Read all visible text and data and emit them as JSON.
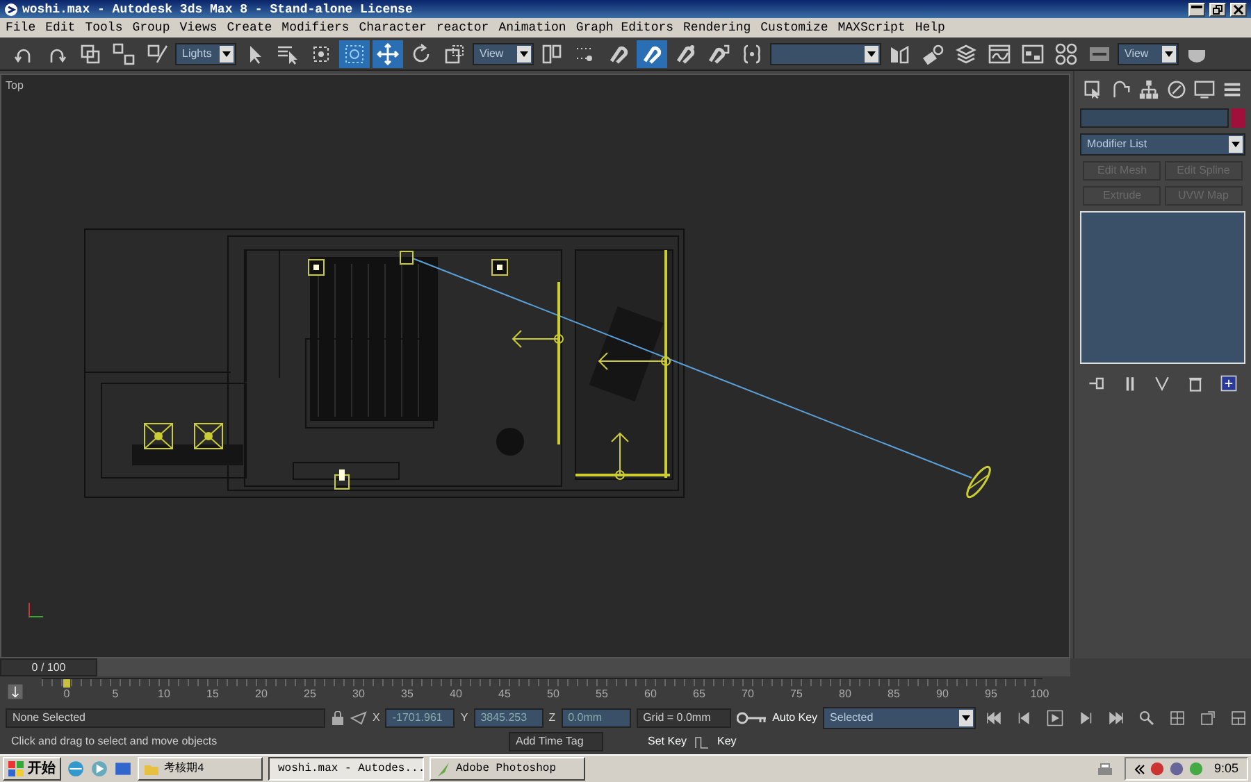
{
  "window": {
    "title": "woshi.max - Autodesk 3ds Max 8  - Stand-alone License"
  },
  "menu": [
    "File",
    "Edit",
    "Tools",
    "Group",
    "Views",
    "Create",
    "Modifiers",
    "Character",
    "reactor",
    "Animation",
    "Graph Editors",
    "Rendering",
    "Customize",
    "MAXScript",
    "Help"
  ],
  "toolbar": [
    {
      "kind": "undo",
      "selected": false
    },
    {
      "kind": "redo",
      "selected": false
    },
    {
      "kind": "link",
      "selected": false
    },
    {
      "kind": "unlink",
      "selected": false
    },
    {
      "kind": "bind",
      "selected": false
    },
    {
      "kind": "dropdown",
      "text": "Lights"
    },
    {
      "kind": "select",
      "selected": false
    },
    {
      "kind": "select-name",
      "selected": false
    },
    {
      "kind": "region",
      "selected": false
    },
    {
      "kind": "window",
      "selected": true
    },
    {
      "kind": "move",
      "selected": true
    },
    {
      "kind": "rotate",
      "selected": false
    },
    {
      "kind": "scale",
      "selected": false
    },
    {
      "kind": "dropdown",
      "text": "View"
    },
    {
      "kind": "pivot",
      "selected": false
    },
    {
      "kind": "manipulate",
      "selected": false
    },
    {
      "kind": "snap",
      "selected": false
    },
    {
      "kind": "angle-snap",
      "selected": true
    },
    {
      "kind": "percent-snap",
      "selected": false
    },
    {
      "kind": "spinner-snap",
      "selected": false
    },
    {
      "kind": "named-sets",
      "selected": false
    },
    {
      "kind": "dropdown"
    },
    {
      "kind": "mirror",
      "selected": false
    },
    {
      "kind": "align",
      "selected": false
    },
    {
      "kind": "layers",
      "selected": false
    },
    {
      "kind": "curve-editor",
      "selected": false
    },
    {
      "kind": "schematic",
      "selected": false
    },
    {
      "kind": "material",
      "selected": false
    },
    {
      "kind": "render-scene",
      "selected": false
    },
    {
      "kind": "dropdown",
      "text": "View"
    },
    {
      "kind": "teapot",
      "selected": false
    }
  ],
  "viewport": {
    "label": "Top"
  },
  "command_panel": {
    "modifier_list": "Modifier List",
    "buttons": [
      {
        "label": "Edit Mesh",
        "disabled": true
      },
      {
        "label": "Edit Spline",
        "disabled": true
      },
      {
        "label": "Extrude",
        "disabled": true
      },
      {
        "label": "UVW Map",
        "disabled": true
      }
    ]
  },
  "time_slider": {
    "reading": "0 / 100",
    "level": 0
  },
  "track_ticks": [
    "0",
    "5",
    "10",
    "15",
    "20",
    "25",
    "30",
    "35",
    "40",
    "45",
    "50",
    "55",
    "60",
    "65",
    "70",
    "75",
    "80",
    "85",
    "90",
    "95",
    "100"
  ],
  "status": {
    "selection": "None Selected",
    "prompt": "Click and drag to select and move objects",
    "coordinates": [
      {
        "axis": "X",
        "value": "-1701.961"
      },
      {
        "axis": "Y",
        "value": "3845.253"
      },
      {
        "axis": "Z",
        "value": "0.0mm"
      }
    ],
    "grid": "Grid = 0.0mm",
    "add_time_tag": "Add Time Tag",
    "auto_key": "Auto Key",
    "key_mode": "Selected",
    "set_key": "Set Key",
    "key_filters": "Key"
  },
  "taskbar": {
    "start": "开始",
    "tasks": [
      {
        "label": "考核期4",
        "selected": false
      },
      {
        "label": "woshi.max - Autodes...",
        "selected": true
      },
      {
        "label": "Adobe Photoshop",
        "selected": false
      }
    ],
    "clock": "9:05"
  }
}
